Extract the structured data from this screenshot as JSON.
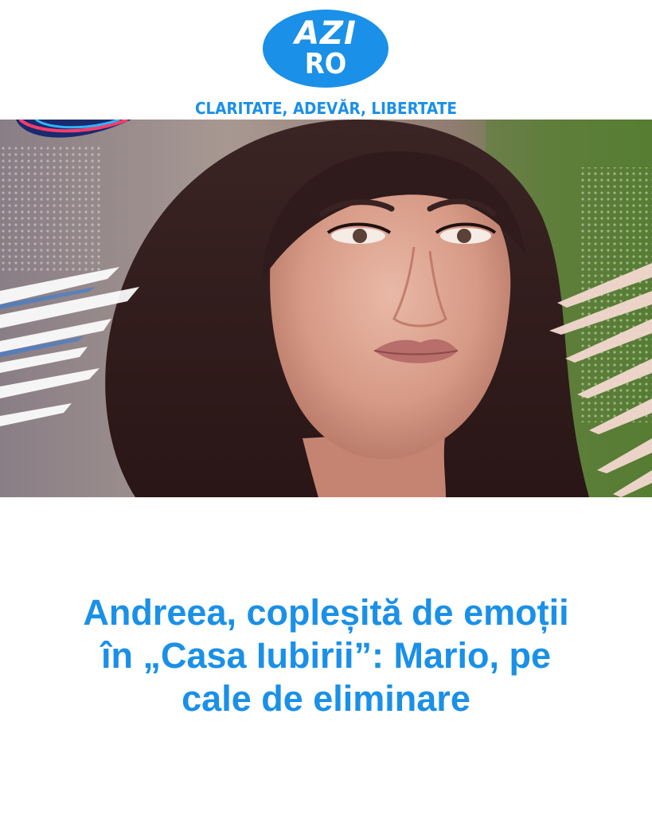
{
  "header": {
    "logo": {
      "line1": "AZI",
      "line2": "RO",
      "color": "#1a90e8"
    },
    "tagline": "CLARITATE, ADEVĂR, LIBERTATE"
  },
  "hero": {
    "image": "portrait-photo",
    "accent_colors": [
      "#ffffff",
      "#f3d9cf",
      "#2b7de0"
    ]
  },
  "article": {
    "title": "Andreea, copleșită de emoții în „Casa Iubirii”: Mario, pe cale de eliminare"
  }
}
